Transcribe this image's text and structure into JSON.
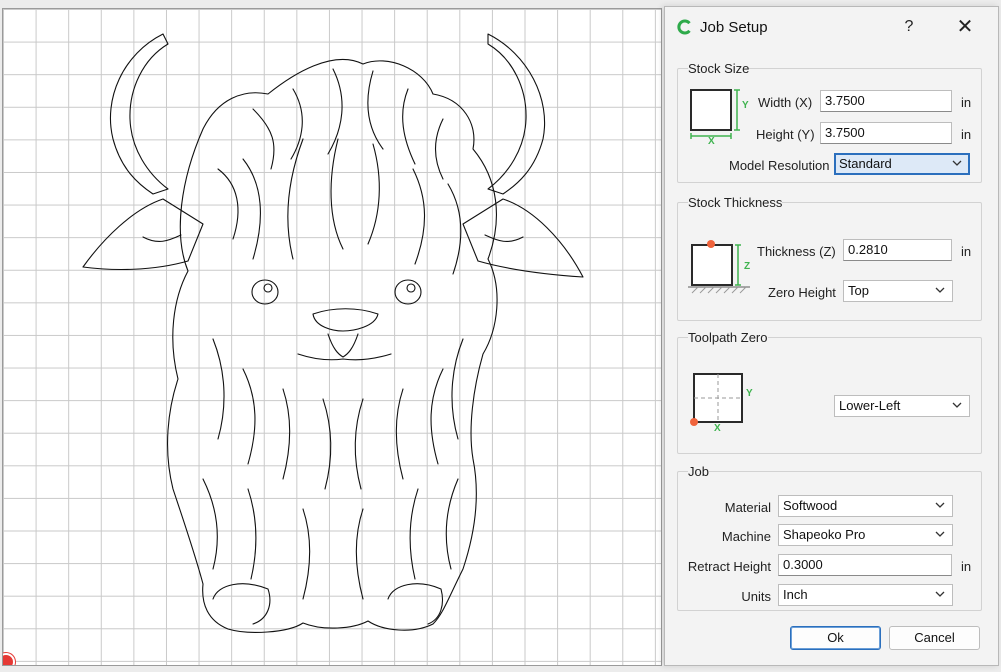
{
  "dialog": {
    "title": "Job Setup",
    "help_label": "?",
    "close_label": "✕",
    "stock_size": {
      "title": "Stock Size",
      "width_label": "Width (X)",
      "width_value": "3.7500",
      "width_unit": "in",
      "height_label": "Height (Y)",
      "height_value": "3.7500",
      "height_unit": "in",
      "resolution_label": "Model Resolution",
      "resolution_value": "Standard",
      "diagram_x": "X",
      "diagram_y": "Y"
    },
    "stock_thickness": {
      "title": "Stock Thickness",
      "thickness_label": "Thickness (Z)",
      "thickness_value": "0.2810",
      "thickness_unit": "in",
      "zero_height_label": "Zero Height",
      "zero_height_value": "Top",
      "diagram_z": "Z"
    },
    "toolpath_zero": {
      "title": "Toolpath Zero",
      "value": "Lower-Left",
      "diagram_x": "X",
      "diagram_y": "Y"
    },
    "job": {
      "title": "Job",
      "material_label": "Material",
      "material_value": "Softwood",
      "machine_label": "Machine",
      "machine_value": "Shapeoko Pro",
      "retract_label": "Retract Height",
      "retract_value": "0.3000",
      "retract_unit": "in",
      "units_label": "Units",
      "units_value": "Inch"
    },
    "ok_label": "Ok",
    "cancel_label": "Cancel"
  },
  "colors": {
    "accent": "#2b6fbd",
    "diagram_green": "#3fb34f",
    "diagram_orange": "#f0643c",
    "app_icon_green": "#2eaa4a"
  },
  "icons": [
    "app-logo-icon",
    "chevron-down-icon",
    "origin-marker-icon"
  ]
}
